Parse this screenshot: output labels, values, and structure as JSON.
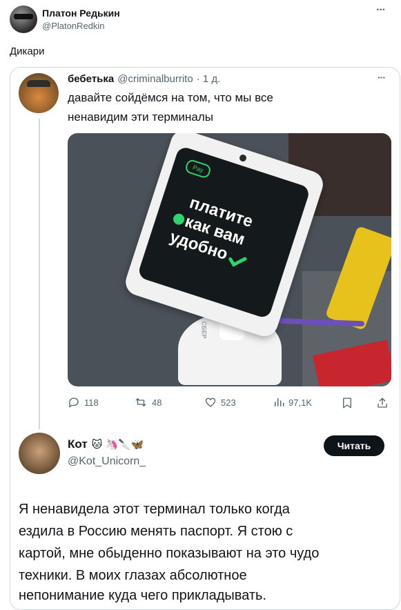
{
  "author": {
    "name": "Платон Редькин",
    "handle": "@PlatonRedkin"
  },
  "tweet_text": "Дикари",
  "more_label": "···",
  "quoted": {
    "name": "бебетька",
    "handle": "@criminalburrito",
    "time": "· 1 д.",
    "text_line1": "давайте сойдёмся на том, что мы все",
    "text_line2": "ненавидим эти терминалы",
    "image_text": {
      "line1": "платите",
      "line2": "как вам",
      "line3": "удобно",
      "badge": "Pay",
      "brand": "СБЕР"
    },
    "metrics": {
      "replies": "118",
      "retweets": "48",
      "likes": "523",
      "views": "97,1K"
    }
  },
  "reply": {
    "name": "Кот",
    "emoji": "🐱 🦄🔪🦋",
    "handle": "@Kot_Unicorn_",
    "follow_label": "Читать",
    "text_line1": "Я ненавидела этот терминал только когда",
    "text_line2": "ездила в Россию менять паспорт. Я стою с",
    "text_line3": "картой, мне обыденно показывают на это чудо",
    "text_line4": "техники. В моих глазах абсолютное",
    "text_line5": "непонимание куда чего прикладывать."
  },
  "colors": {
    "accent_green": "#1ea34a",
    "text": "#0f1419",
    "muted": "#536471",
    "border": "#cfd9de"
  }
}
